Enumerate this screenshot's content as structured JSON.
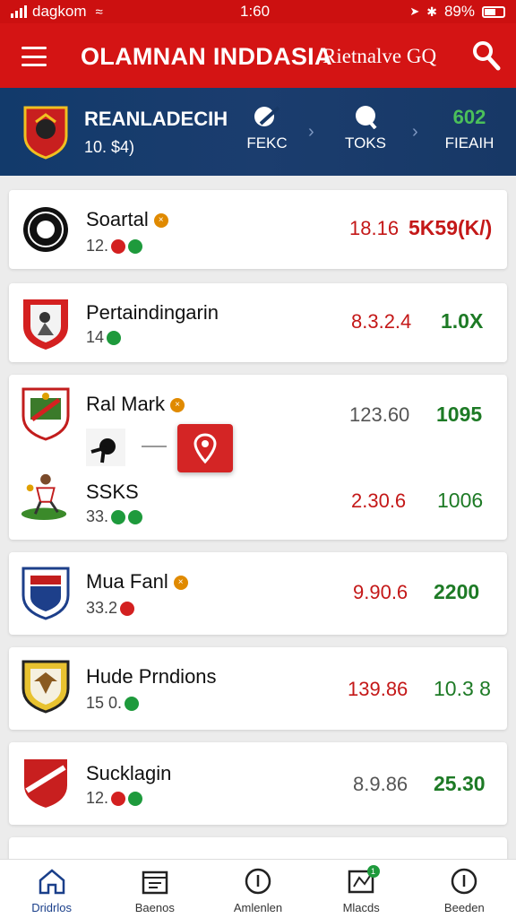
{
  "status_bar": {
    "carrier": "dagkom",
    "time": "1:60",
    "battery": "89%"
  },
  "app_bar": {
    "title": "OLAMNAN INDDASIA",
    "subtitle": "Rietnalve GQ"
  },
  "league": {
    "name": "REANLADECIH",
    "score": "10. $4)",
    "stats": [
      {
        "label": "FEKC",
        "top": ""
      },
      {
        "label": "TOKS",
        "top": ""
      },
      {
        "label": "FIEAIH",
        "top": "602"
      }
    ]
  },
  "rows": [
    {
      "name": "Soartal",
      "sub": "12.",
      "v1": "18.16",
      "v2": "5K59(K/)"
    },
    {
      "name": "Pertaindingarin",
      "sub": "14",
      "v1": "8.3.2.4",
      "v2": "1.0X"
    },
    {
      "name": "Ral  Mark",
      "sub": "",
      "v1": "123.60",
      "v2": "1095"
    },
    {
      "name": "SSKS",
      "sub": "33.",
      "v1": "2.30.6",
      "v2": "1006"
    },
    {
      "name": "Mua Fanl",
      "sub": "33.2",
      "v1": "9.90.6",
      "v2": "2200"
    },
    {
      "name": "Hude Prndions",
      "sub": "15 0.",
      "v1": "139.86",
      "v2": "10.3 8"
    },
    {
      "name": "Sucklagin",
      "sub": "12.",
      "v1": "8.9.86",
      "v2": "25.30"
    }
  ],
  "nav": [
    {
      "label": "Dridrlos"
    },
    {
      "label": "Baenos"
    },
    {
      "label": "Amlenlen"
    },
    {
      "label": "Mlacds",
      "badge": "1"
    },
    {
      "label": "Beeden"
    }
  ],
  "colors": {
    "primary": "#d41414",
    "league_bg": "#173866",
    "positive": "#1d7a25",
    "negative": "#c41818"
  }
}
